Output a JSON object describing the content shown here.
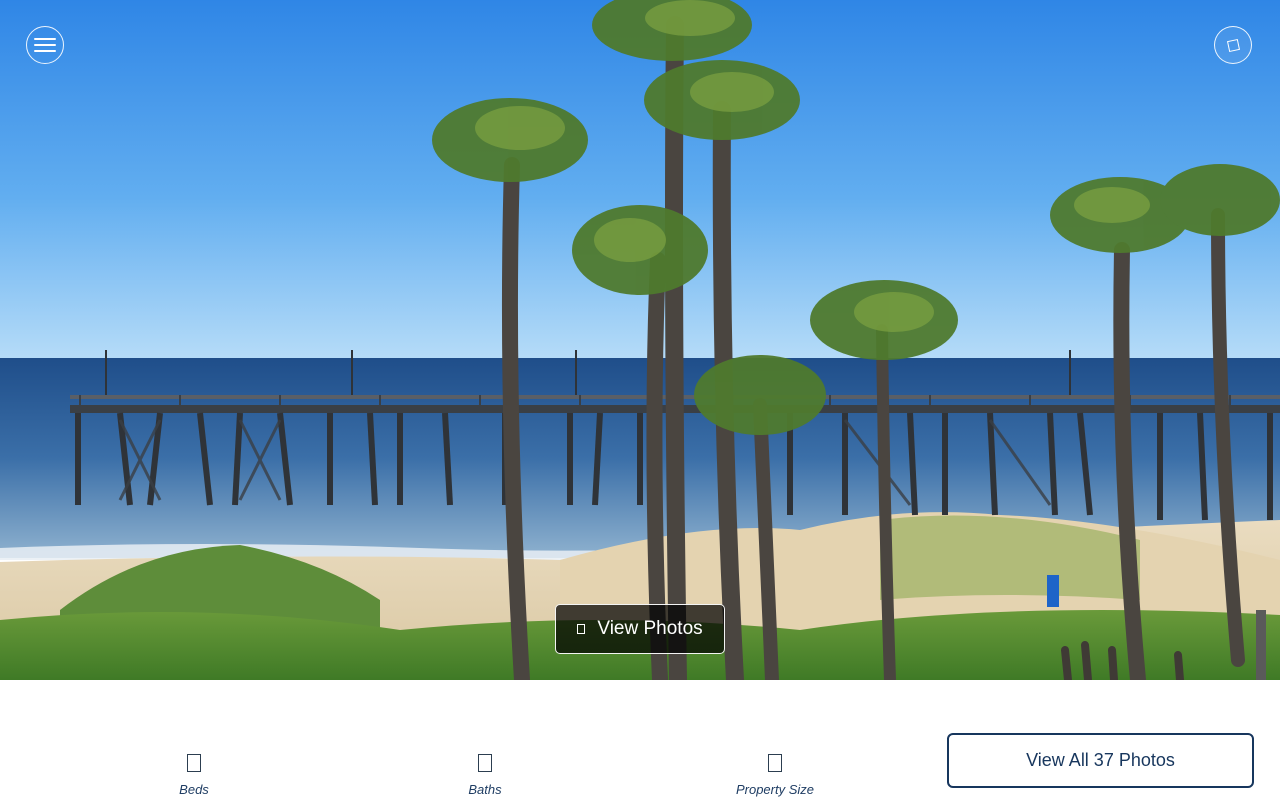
{
  "hero": {
    "view_photos_label": "View Photos"
  },
  "header": {
    "menu_icon": "hamburger-menu-icon",
    "share_icon": "share-icon"
  },
  "stats": [
    {
      "label": "Beds",
      "icon": "bed-icon"
    },
    {
      "label": "Baths",
      "icon": "bath-icon"
    },
    {
      "label": "Property Size",
      "icon": "ruler-icon"
    }
  ],
  "actions": {
    "view_all_label": "View All 37 Photos"
  },
  "colors": {
    "brand_navy": "#17365d"
  }
}
